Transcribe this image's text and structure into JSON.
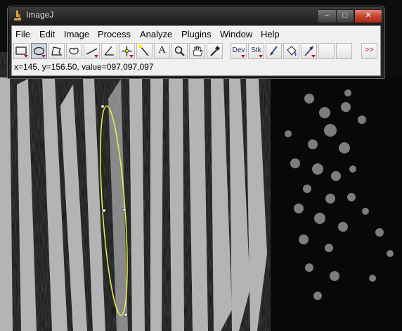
{
  "window": {
    "title": "ImageJ",
    "controls": {
      "min": "−",
      "max": "□",
      "close": "✕"
    }
  },
  "menubar": {
    "items": [
      "File",
      "Edit",
      "Image",
      "Process",
      "Analyze",
      "Plugins",
      "Window",
      "Help"
    ]
  },
  "toolbar": {
    "tools": [
      {
        "name": "rectangle-tool"
      },
      {
        "name": "oval-tool",
        "selected": true
      },
      {
        "name": "polygon-tool"
      },
      {
        "name": "freehand-tool"
      },
      {
        "name": "line-tool"
      },
      {
        "name": "angle-tool"
      },
      {
        "name": "point-tool"
      },
      {
        "name": "wand-tool"
      },
      {
        "name": "text-tool",
        "label": "A"
      },
      {
        "name": "magnifier-tool"
      },
      {
        "name": "scroll-tool"
      },
      {
        "name": "dropper-tool"
      },
      {
        "name": "dev-tool",
        "label": "Dev"
      },
      {
        "name": "stk-tool",
        "label": "Stk"
      },
      {
        "name": "brush-tool"
      },
      {
        "name": "flood-fill-tool"
      },
      {
        "name": "arrow-tool"
      },
      {
        "name": "blank-tool-1"
      },
      {
        "name": "blank-tool-2"
      },
      {
        "name": "more-tools",
        "label": ">>"
      }
    ]
  },
  "status": {
    "text": "x=145, y=156.50, value=097,097,097"
  },
  "colors": {
    "roi": "#f2f04a",
    "close_red": "#c3452e"
  }
}
